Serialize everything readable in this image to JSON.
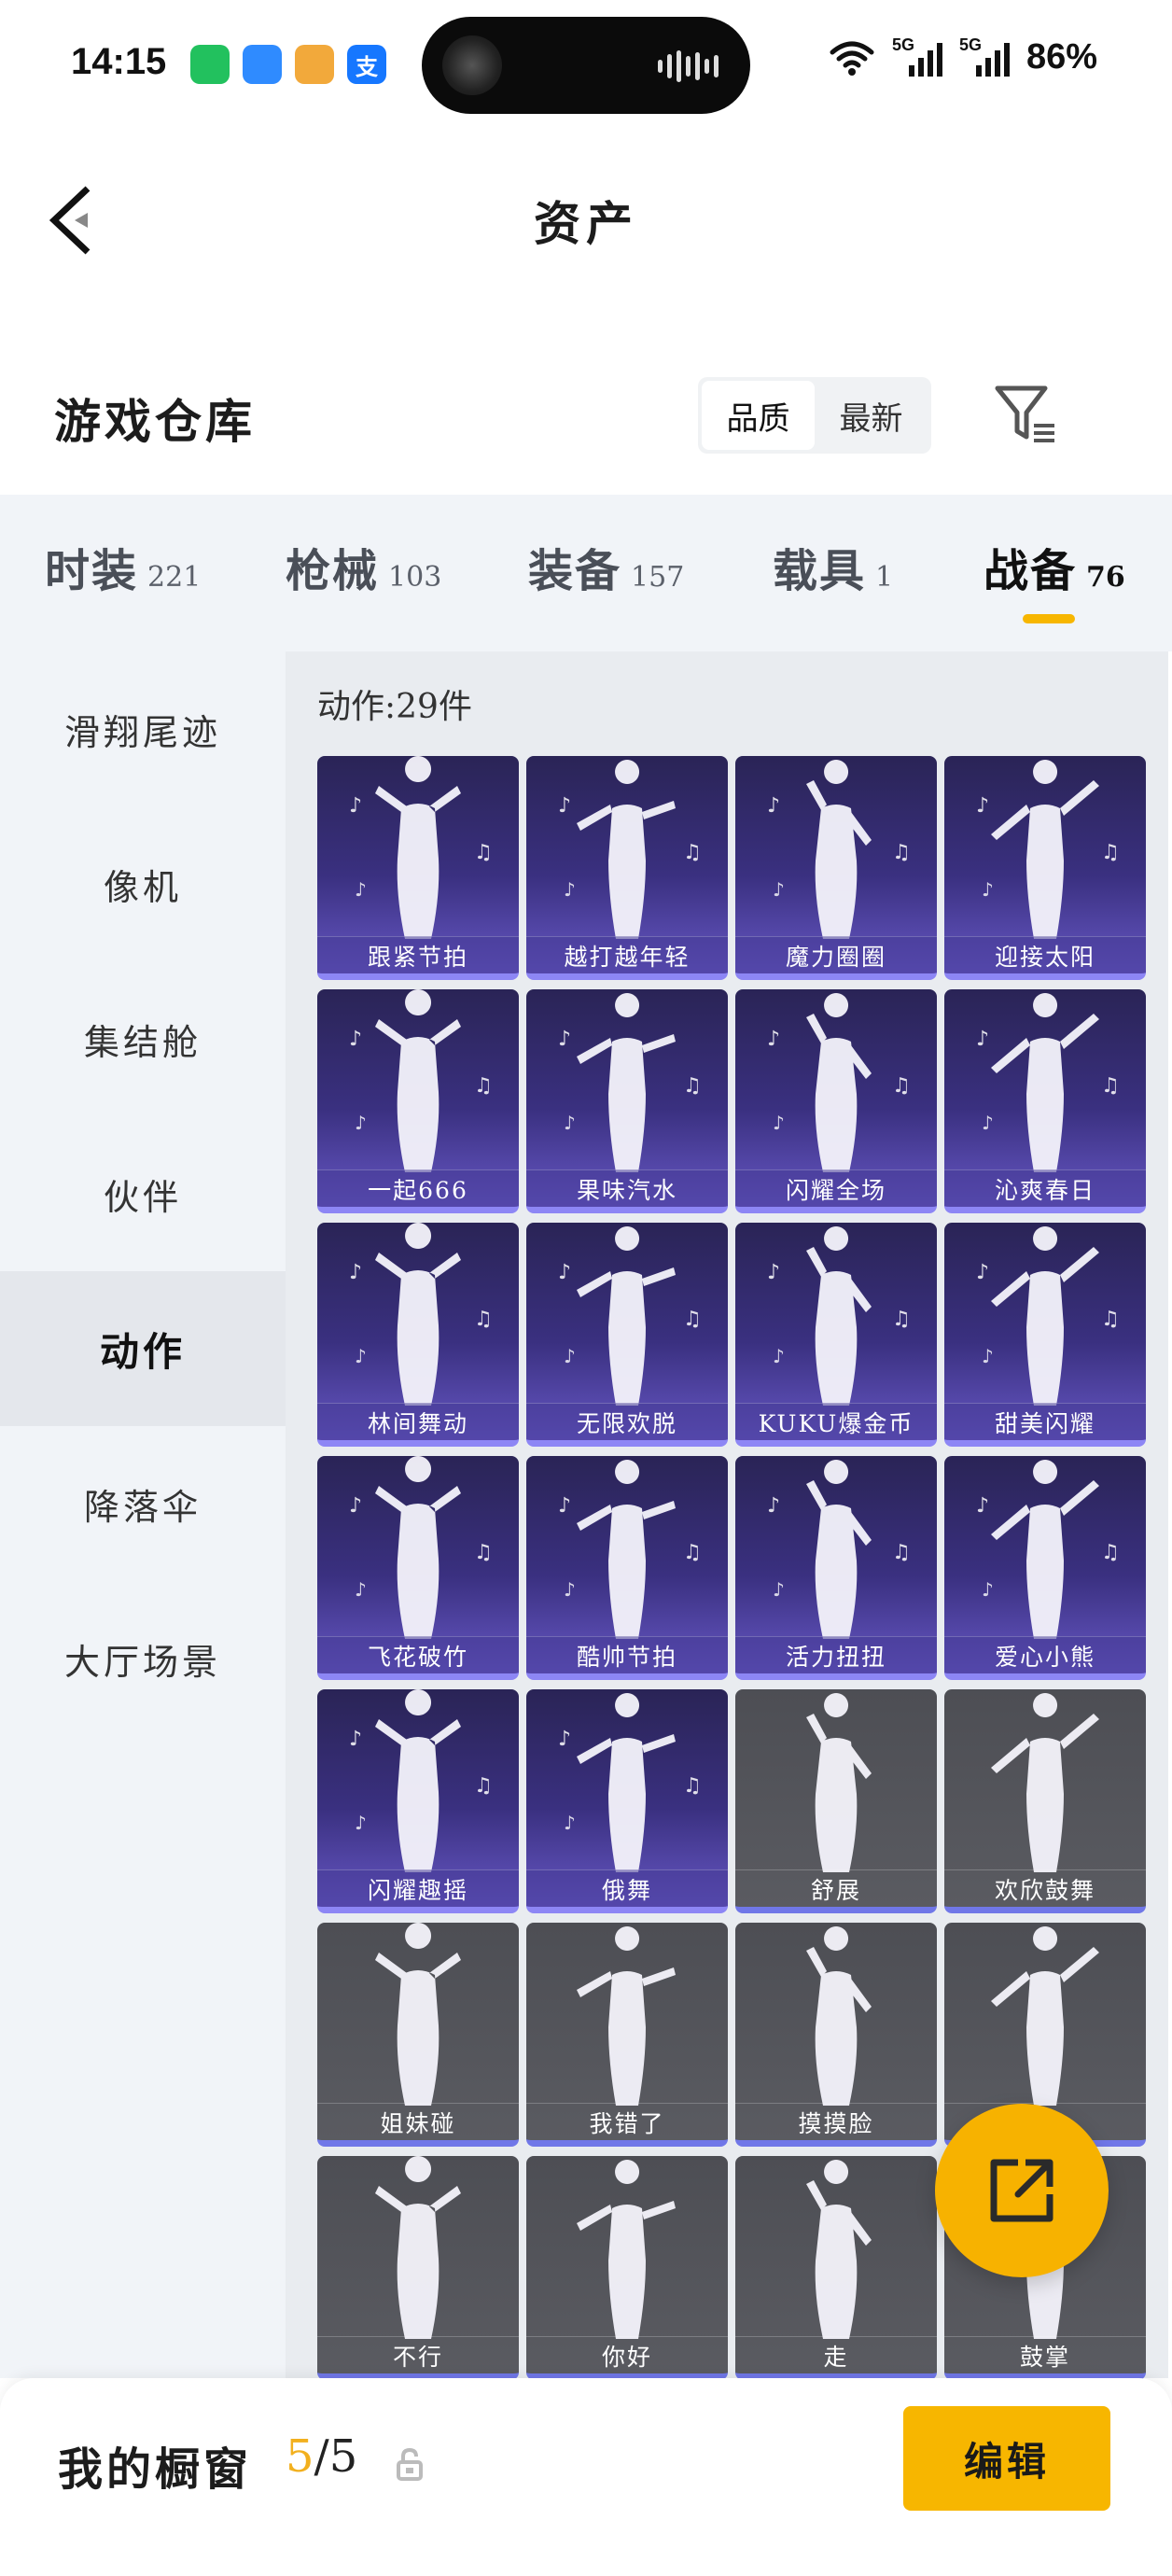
{
  "status_bar": {
    "time": "14:15",
    "apps": [
      {
        "icon": "wechat-icon",
        "glyph": "",
        "color": "#22c15e"
      },
      {
        "icon": "qq-browser-icon",
        "glyph": "",
        "color": "#2f8bff"
      },
      {
        "icon": "music-app-icon",
        "glyph": "",
        "color": "#f2a93b"
      },
      {
        "icon": "alipay-icon",
        "glyph": "支",
        "color": "#1677ff"
      }
    ],
    "signal_1": "5G",
    "signal_2": "5G",
    "battery": "86%"
  },
  "header": {
    "title": "资产"
  },
  "section": {
    "title": "游戏仓库",
    "sort_options": [
      {
        "label": "品质",
        "active": true
      },
      {
        "label": "最新",
        "active": false
      }
    ]
  },
  "tabs": [
    {
      "label": "时装",
      "count": "221",
      "active": false
    },
    {
      "label": "枪械",
      "count": "103",
      "active": false
    },
    {
      "label": "装备",
      "count": "157",
      "active": false
    },
    {
      "label": "载具",
      "count": "1",
      "active": false
    },
    {
      "label": "战备",
      "count": "76",
      "active": true
    }
  ],
  "sidebar": [
    {
      "label": "滑翔尾迹",
      "active": false
    },
    {
      "label": "像机",
      "active": false
    },
    {
      "label": "集结舱",
      "active": false
    },
    {
      "label": "伙伴",
      "active": false
    },
    {
      "label": "动作",
      "active": true
    },
    {
      "label": "降落伞",
      "active": false
    },
    {
      "label": "大厅场景",
      "active": false
    }
  ],
  "content": {
    "count_line": "动作:29件",
    "items": [
      {
        "name": "跟紧节拍",
        "style": "purple"
      },
      {
        "name": "越打越年轻",
        "style": "purple"
      },
      {
        "name": "魔力圈圈",
        "style": "purple"
      },
      {
        "name": "迎接太阳",
        "style": "purple"
      },
      {
        "name": "一起666",
        "style": "purple"
      },
      {
        "name": "果味汽水",
        "style": "purple"
      },
      {
        "name": "闪耀全场",
        "style": "purple"
      },
      {
        "name": "沁爽春日",
        "style": "purple"
      },
      {
        "name": "林间舞动",
        "style": "purple"
      },
      {
        "name": "无限欢脱",
        "style": "purple"
      },
      {
        "name": "KUKU爆金币",
        "style": "purple"
      },
      {
        "name": "甜美闪耀",
        "style": "purple"
      },
      {
        "name": "飞花破竹",
        "style": "purple"
      },
      {
        "name": "酷帅节拍",
        "style": "purple"
      },
      {
        "name": "活力扭扭",
        "style": "purple"
      },
      {
        "name": "爱心小熊",
        "style": "purple"
      },
      {
        "name": "闪耀趣摇",
        "style": "purple"
      },
      {
        "name": "俄舞",
        "style": "purple"
      },
      {
        "name": "舒展",
        "style": "grey"
      },
      {
        "name": "欢欣鼓舞",
        "style": "grey"
      },
      {
        "name": "姐妹碰",
        "style": "grey"
      },
      {
        "name": "我错了",
        "style": "grey"
      },
      {
        "name": "摸摸脸",
        "style": "grey"
      },
      {
        "name": "",
        "style": "grey"
      },
      {
        "name": "不行",
        "style": "grey"
      },
      {
        "name": "你好",
        "style": "grey"
      },
      {
        "name": "走",
        "style": "grey"
      },
      {
        "name": "鼓掌",
        "style": "grey"
      }
    ]
  },
  "fab": {
    "icon": "share-external-icon"
  },
  "bottom": {
    "showcase_label": "我的橱窗",
    "used": "5",
    "sep_total": "/5",
    "edit_label": "编辑"
  }
}
